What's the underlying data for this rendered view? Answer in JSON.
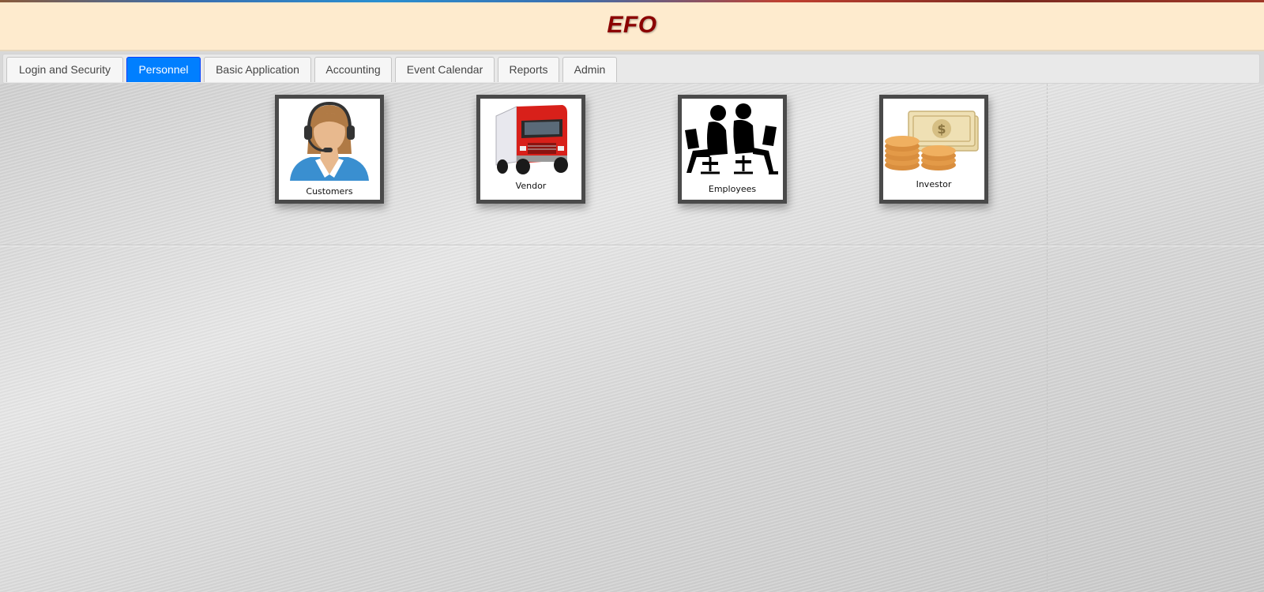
{
  "app": {
    "title": "EFO"
  },
  "tabs": [
    {
      "label": "Login and Security",
      "active": false
    },
    {
      "label": "Personnel",
      "active": true
    },
    {
      "label": "Basic Application",
      "active": false
    },
    {
      "label": "Accounting",
      "active": false
    },
    {
      "label": "Event Calendar",
      "active": false
    },
    {
      "label": "Reports",
      "active": false
    },
    {
      "label": "Admin",
      "active": false
    }
  ],
  "tiles": [
    {
      "label": "Customers",
      "icon": "customer-service-agent-icon"
    },
    {
      "label": "Vendor",
      "icon": "truck-icon"
    },
    {
      "label": "Employees",
      "icon": "employees-laptops-icon"
    },
    {
      "label": "Investor",
      "icon": "money-coins-icon"
    }
  ],
  "colors": {
    "header_bg": "#feebce",
    "title": "#8b0000",
    "active_tab": "#007fff",
    "tile_border": "#4a4a4a"
  }
}
